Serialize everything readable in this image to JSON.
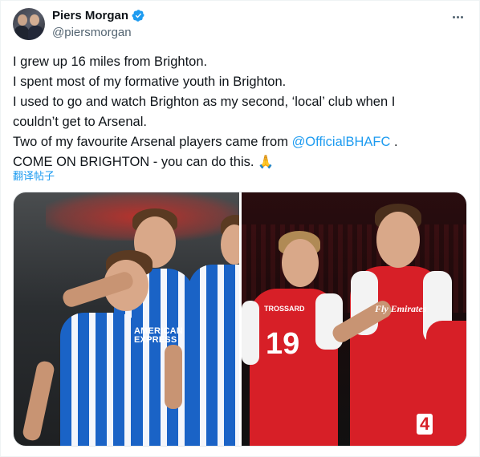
{
  "author": {
    "display_name": "Piers Morgan",
    "handle": "@piersmorgan",
    "avatar_icon": "avatar-photo",
    "verified_icon": "verified-badge-icon",
    "verified_color": "#1d9bf0"
  },
  "menu": {
    "icon": "more-options-icon"
  },
  "tweet": {
    "lines": [
      "I grew up 16 miles from Brighton.",
      "I spent most of my formative youth in Brighton.",
      "I used to go and watch Brighton as my second, ‘local’ club when I",
      "couldn’t get to Arsenal."
    ],
    "line5_before": "Two of my favourite Arsenal players came from ",
    "mention": "@OfficialBHAFC",
    "line5_after": " .",
    "line6": "COME ON BRIGHTON - you can do this. ",
    "emoji": "🙏",
    "translate_label": "翻译帖子"
  },
  "media": {
    "left_photo": {
      "sponsor_line1": "AMERICAN",
      "sponsor_line2": "EXPRESS"
    },
    "right_photo": {
      "shirt_number_left": "19",
      "shirt_name_left": "TROSSARD",
      "shirt_number_right": "4",
      "sponsor": "Fly Emirates"
    }
  },
  "colors": {
    "link": "#1d9bf0",
    "text": "#0f1419",
    "secondary": "#536471",
    "brighton_blue": "#1a63c6",
    "arsenal_red": "#d71f27"
  }
}
